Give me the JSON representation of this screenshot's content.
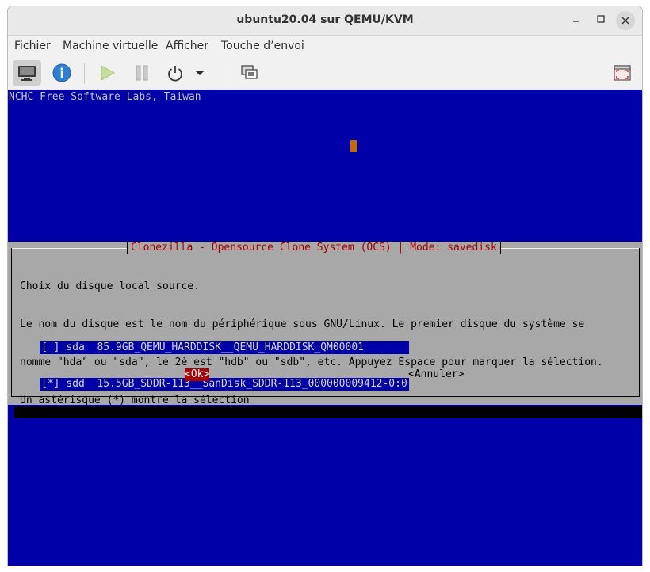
{
  "window": {
    "title": "ubuntu20.04 sur QEMU/KVM"
  },
  "menubar": {
    "items": [
      "Fichier",
      "Machine virtuelle",
      "Afficher",
      "Touche d’envoi"
    ]
  },
  "toolbar": {
    "buttons": [
      {
        "name": "console-view",
        "icon": "monitor-icon",
        "active": true
      },
      {
        "name": "details-view",
        "icon": "info-icon"
      },
      {
        "name": "run",
        "icon": "play-icon",
        "disabled": true
      },
      {
        "name": "pause",
        "icon": "pause-icon",
        "disabled": true
      },
      {
        "name": "shutdown",
        "icon": "power-icon"
      },
      {
        "name": "shutdown-menu",
        "icon": "chevron-down-icon"
      },
      {
        "name": "snapshots",
        "icon": "snapshot-icon"
      },
      {
        "name": "fullscreen",
        "icon": "fullscreen-icon"
      }
    ]
  },
  "console": {
    "header": "NCHC Free Software Labs, Taiwan",
    "dialog": {
      "title": "Clonezilla - Opensource Clone System (OCS) | Mode: savedisk",
      "lines": [
        "Choix du disque local source.",
        "Le nom du disque est le nom du périphérique sous GNU/Linux. Le premier disque du système se",
        "nomme \"hda\" ou \"sda\", le 2è est \"hdb\" ou \"sdb\", etc. Appuyez Espace pour marquer la sélection.",
        "Un astérisque (*) montre la sélection"
      ],
      "items": [
        "[ ] sda  85.9GB_QEMU_HARDDISK__QEMU_HARDDISK_QM00001",
        "[*] sdd  15.5GB_SDDR-113__SanDisk_SDDR-113_000000009412-0:0"
      ],
      "ok": "<Ok>",
      "cancel": "<Annuler>"
    }
  },
  "colors": {
    "console_bg": "#0000a8",
    "dialog_bg": "#a8a8a8",
    "title_red": "#a80000",
    "cursor": "#c36b00"
  }
}
